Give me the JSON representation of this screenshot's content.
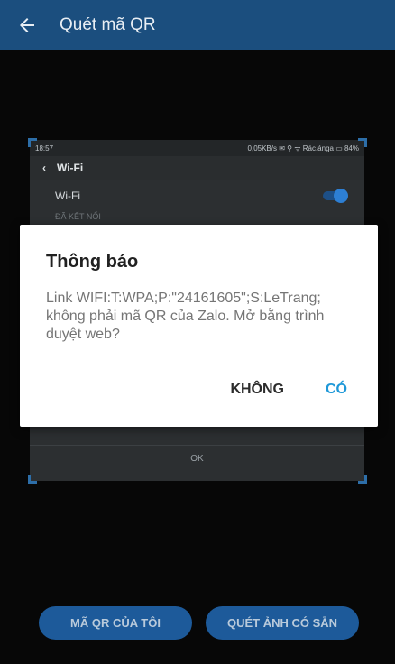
{
  "header": {
    "title": "Quét mã QR",
    "back_icon": "arrow-left-icon"
  },
  "preview": {
    "status_time": "18:57",
    "status_right": "0,05KB/s ✉ ⚲ ᯤ Rác.ánga ▭ 84%",
    "wifi_header": "Wi-Fi",
    "wifi_row_label": "Wi-Fi",
    "connected_label": "ĐÃ KẾT NỐI",
    "ok_label": "OK"
  },
  "dialog": {
    "title": "Thông báo",
    "message": "Link WIFI:T:WPA;P:\"24161605\";S:LeTrang; không phải mã QR của Zalo. Mở bằng trình duyệt web?",
    "no_label": "KHÔNG",
    "yes_label": "CÓ"
  },
  "bottom": {
    "my_qr_label": "MÃ QR CỦA TÔI",
    "scan_image_label": "QUÉT ẢNH CÓ SẴN"
  },
  "colors": {
    "header_bg": "#1b4e7e",
    "accent": "#1e98d8",
    "bottom_button_bg": "#1d5a9a"
  }
}
